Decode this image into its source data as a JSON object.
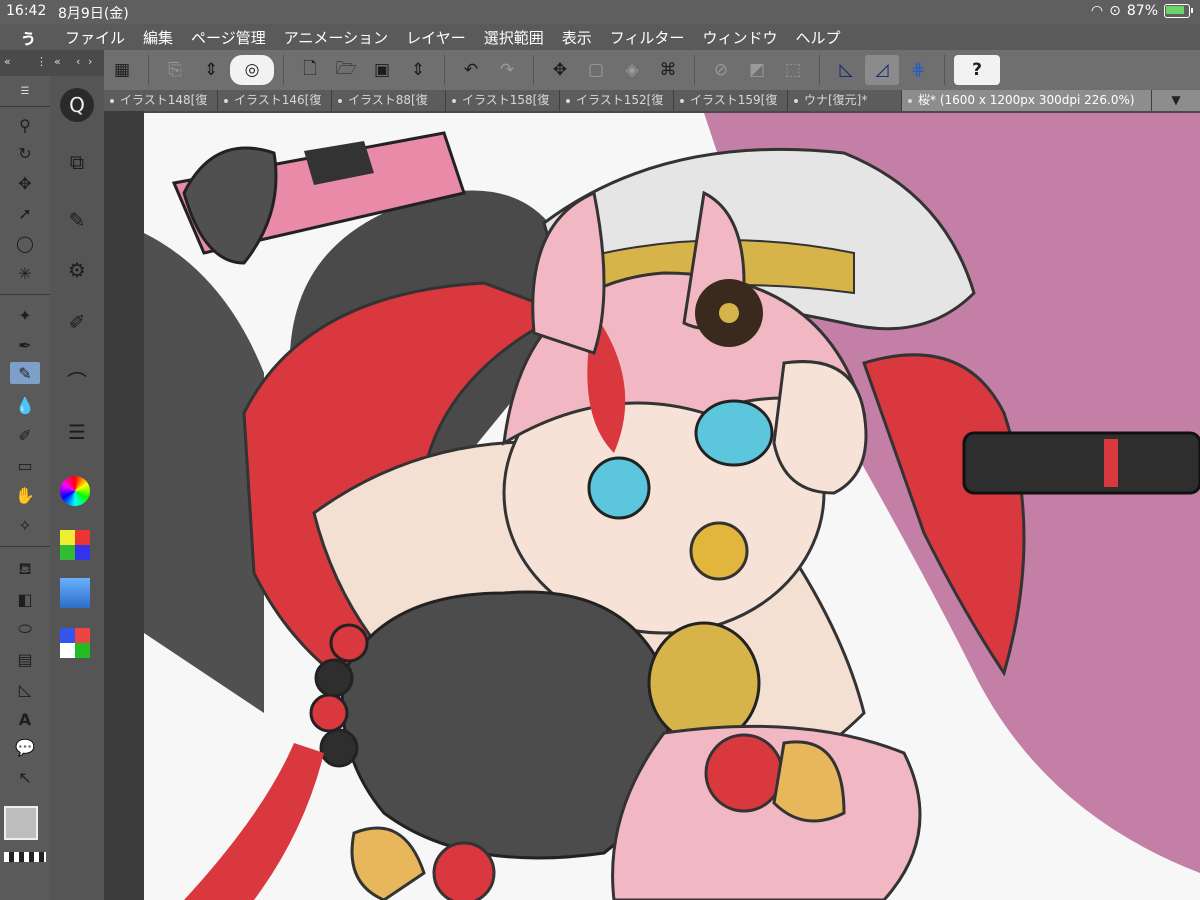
{
  "status_bar": {
    "time": "16:42",
    "date": "8月9日(金)",
    "battery": "87%"
  },
  "menu": {
    "logo": "ぅ",
    "items": [
      "ファイル",
      "編集",
      "ページ管理",
      "アニメーション",
      "レイヤー",
      "選択範囲",
      "表示",
      "フィルター",
      "ウィンドウ",
      "ヘルプ"
    ]
  },
  "tabs": [
    {
      "label": "イラスト148[復"
    },
    {
      "label": "イラスト146[復"
    },
    {
      "label": "イラスト88[復"
    },
    {
      "label": "イラスト158[復"
    },
    {
      "label": "イラスト152[復"
    },
    {
      "label": "イラスト159[復"
    },
    {
      "label": "ウナ[復元]*"
    },
    {
      "label": "桜* (1600 x 1200px 300dpi 226.0%)"
    }
  ],
  "toolbar": {
    "help_label": "?"
  },
  "colors": {
    "accent": "#7ea0c8",
    "hair_red": "#d9383f",
    "pink_bg": "#c47fa6",
    "skin": "#f6e2d6"
  }
}
